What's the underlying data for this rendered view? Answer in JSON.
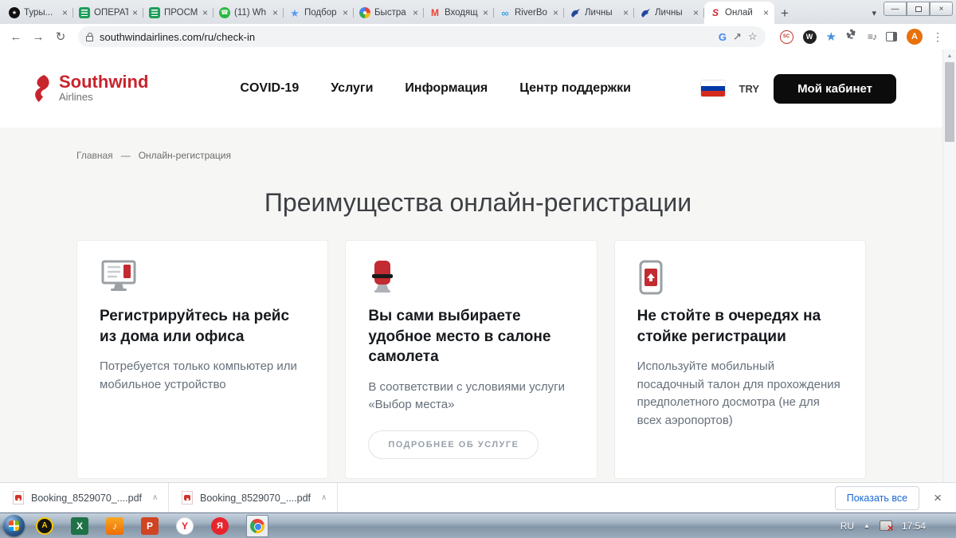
{
  "icons": {
    "close": "×",
    "new_tab": "+",
    "tab_search": "▾",
    "minimize": "—",
    "back": "←",
    "forward": "→",
    "reload": "↻",
    "share": "↗",
    "bookmark_star": "☆",
    "google_g": "G",
    "ext_star": "★",
    "ext_playlist": "≡♪",
    "menu_dots": "⋮",
    "scroll_up": "▲",
    "chevron_up": "∧",
    "tray_expand": "▲"
  },
  "browser": {
    "tabs": [
      {
        "title": "Туры...",
        "icon": "compass-icon",
        "glyph": "★"
      },
      {
        "title": "ОПЕРАТ",
        "icon": "sheets-icon",
        "glyph": ""
      },
      {
        "title": "ПРОСМ",
        "icon": "sheets-icon",
        "glyph": ""
      },
      {
        "title": "(11) Wh",
        "icon": "whatsapp-icon",
        "glyph": "☎"
      },
      {
        "title": "Подбор",
        "icon": "star-icon",
        "glyph": "★"
      },
      {
        "title": "Быстра",
        "icon": "pinwheel-icon",
        "glyph": ""
      },
      {
        "title": "Входящ",
        "icon": "gmail-icon",
        "glyph": "M"
      },
      {
        "title": "RiverBo",
        "icon": "infinity-icon",
        "glyph": "∞"
      },
      {
        "title": "Личны",
        "icon": "bird-icon",
        "glyph": ""
      },
      {
        "title": "Личны",
        "icon": "bird-icon",
        "glyph": ""
      },
      {
        "title": "Онлай",
        "icon": "southwind-icon",
        "glyph": "S"
      }
    ],
    "address": {
      "url": "southwindairlines.com/ru/check-in"
    },
    "extensions": {
      "sc": "SC",
      "w": "W"
    },
    "profile_initial": "A"
  },
  "site": {
    "logo": {
      "name": "Southwind",
      "sub": "Airlines"
    },
    "nav": [
      {
        "label": "COVID-19"
      },
      {
        "label": "Услуги"
      },
      {
        "label": "Информация"
      },
      {
        "label": "Центр поддержки"
      }
    ],
    "currency": "TRY",
    "account_button": "Мой кабинет",
    "breadcrumb": {
      "home": "Главная",
      "sep": "—",
      "current": "Онлайн-регистрация"
    },
    "heading": "Преимущества онлайн-регистрации",
    "cards": [
      {
        "icon": "desktop-checkin-icon",
        "title": "Регистрируйтесь на рейс из дома или офиса",
        "body": "Потребуется только компьютер или мобильное устройство"
      },
      {
        "icon": "seat-icon",
        "title": "Вы сами выбираете удобное место в салоне самолета",
        "body": "В соответствии с условиями услуги «Выбор места»",
        "button": "ПОДРОБНЕЕ ОБ УСЛУГЕ"
      },
      {
        "icon": "mobile-boarding-pass-icon",
        "title": "Не стойте в очередях на стойке регистрации",
        "body": "Используйте мобильный посадочный талон для прохождения предполетного досмотра (не для всех аэропортов)"
      }
    ],
    "colors": {
      "brand_red": "#c8242e"
    }
  },
  "downloads": {
    "items": [
      {
        "name": "Booking_8529070_....pdf"
      },
      {
        "name": "Booking_8529070_....pdf"
      }
    ],
    "show_all": "Показать все"
  },
  "taskbar": {
    "apps": [
      {
        "name": "app-a",
        "glyph": "A"
      },
      {
        "name": "excel",
        "glyph": "X"
      },
      {
        "name": "music-app",
        "glyph": "♪"
      },
      {
        "name": "powerpoint",
        "glyph": "P"
      },
      {
        "name": "yandex-search",
        "glyph": "Y"
      },
      {
        "name": "yandex-browser",
        "glyph": "Я"
      },
      {
        "name": "chrome",
        "glyph": ""
      }
    ],
    "tray": {
      "lang": "RU",
      "time": "17:54"
    }
  }
}
